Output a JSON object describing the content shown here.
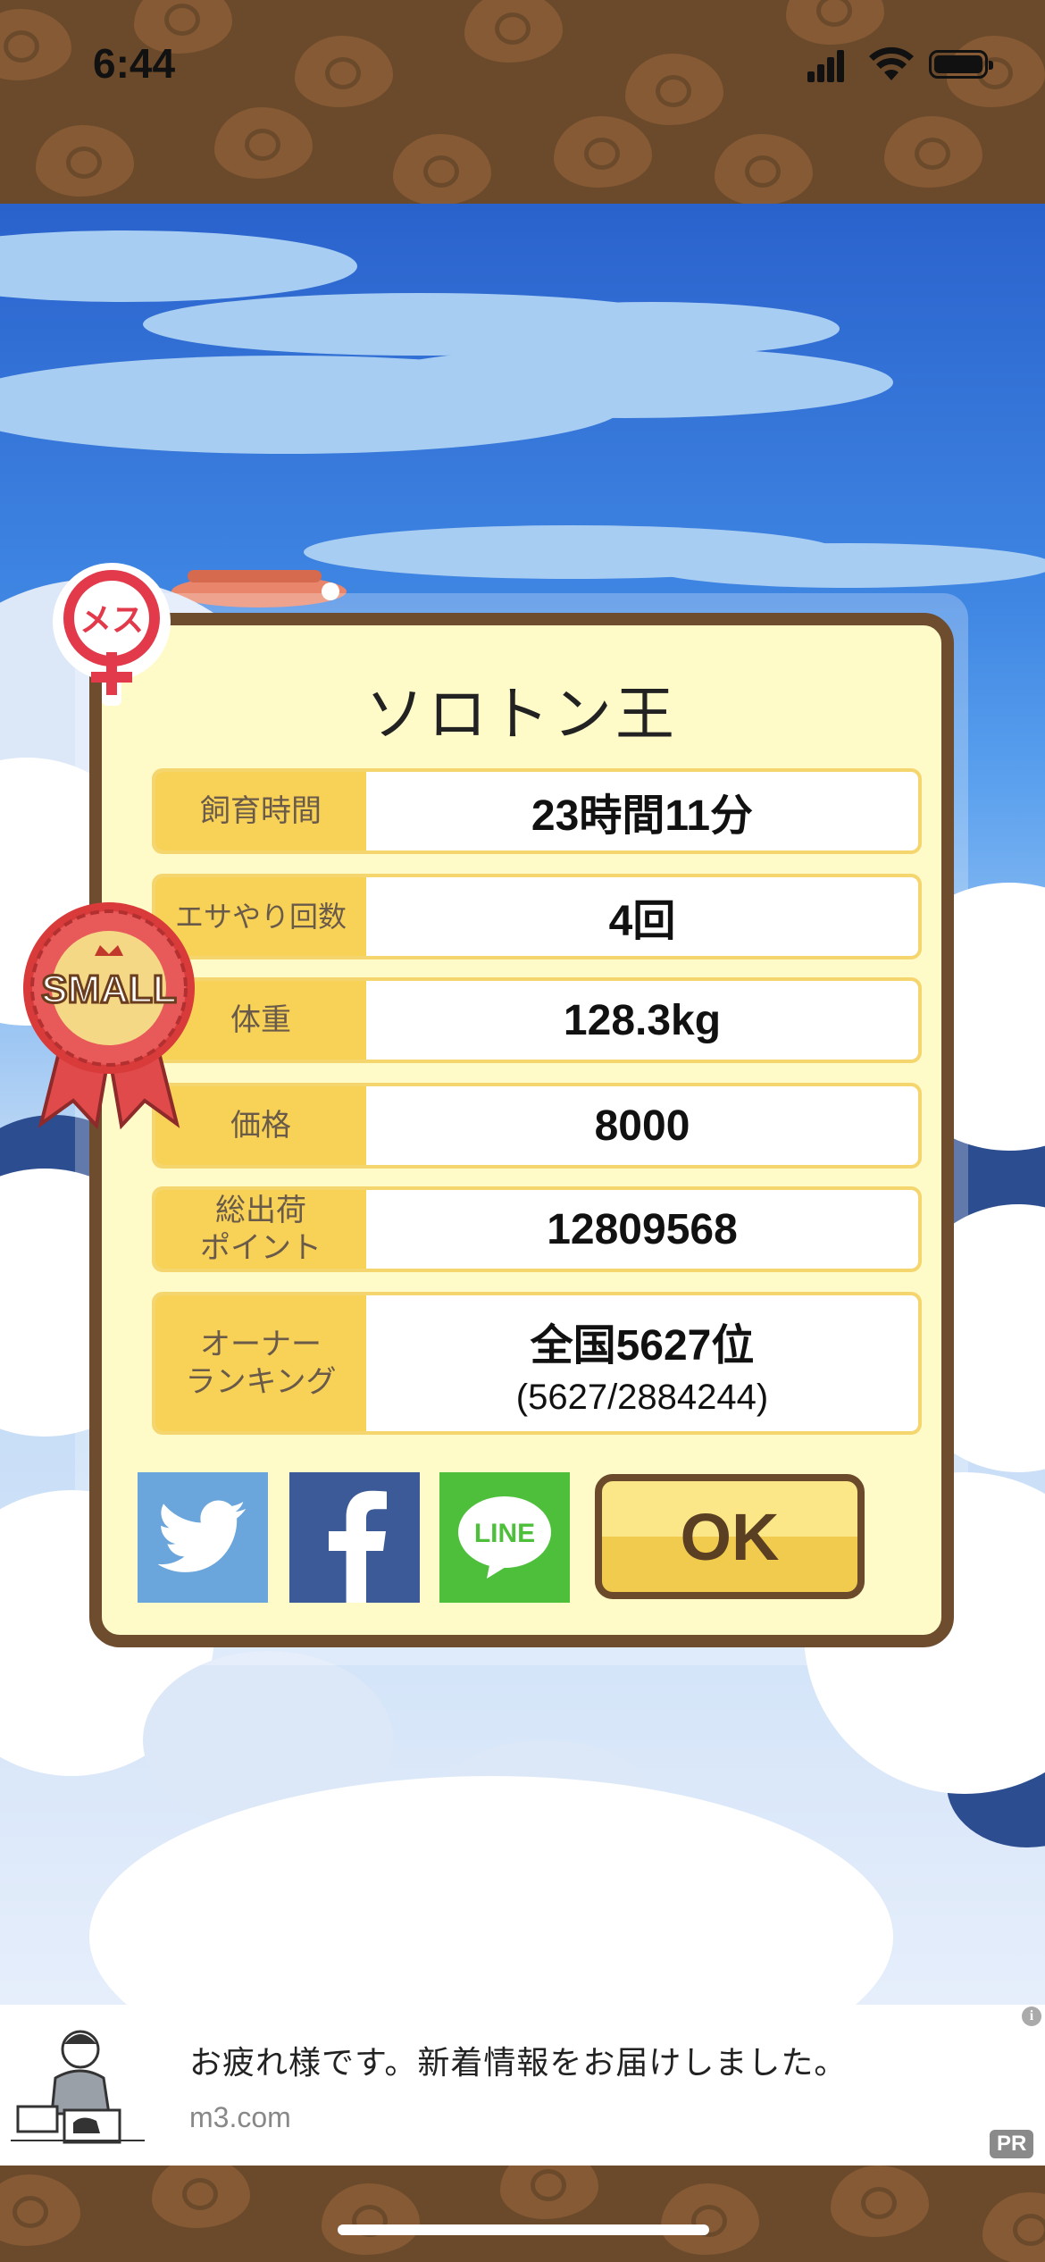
{
  "status_bar": {
    "time": "6:44"
  },
  "dialog": {
    "title": "ソロトン王",
    "rows": [
      {
        "label": "飼育時間",
        "value": "23時間11分"
      },
      {
        "label": "エサやり回数",
        "value": "4回"
      },
      {
        "label": "体重",
        "value": "128.3kg"
      },
      {
        "label": "価格",
        "value": "8000"
      },
      {
        "label": "総出荷\nポイント",
        "value": "12809568"
      },
      {
        "label": "オーナー\nランキング",
        "value": "全国5627位",
        "sub": "(5627/2884244)"
      }
    ],
    "ok_label": "OK",
    "share": {
      "line_label": "LINE"
    }
  },
  "badges": {
    "gender": "メス",
    "size": "SMALL"
  },
  "ad": {
    "text": "お疲れ様です。新着情報をお届けしました。",
    "domain": "m3.com",
    "pr": "PR",
    "info": "i"
  },
  "colors": {
    "dialog_bg": "#fffbc9",
    "dialog_border": "#6d4d2d",
    "label_bg": "#f7d257",
    "ok_button": "#f0cb4d"
  }
}
